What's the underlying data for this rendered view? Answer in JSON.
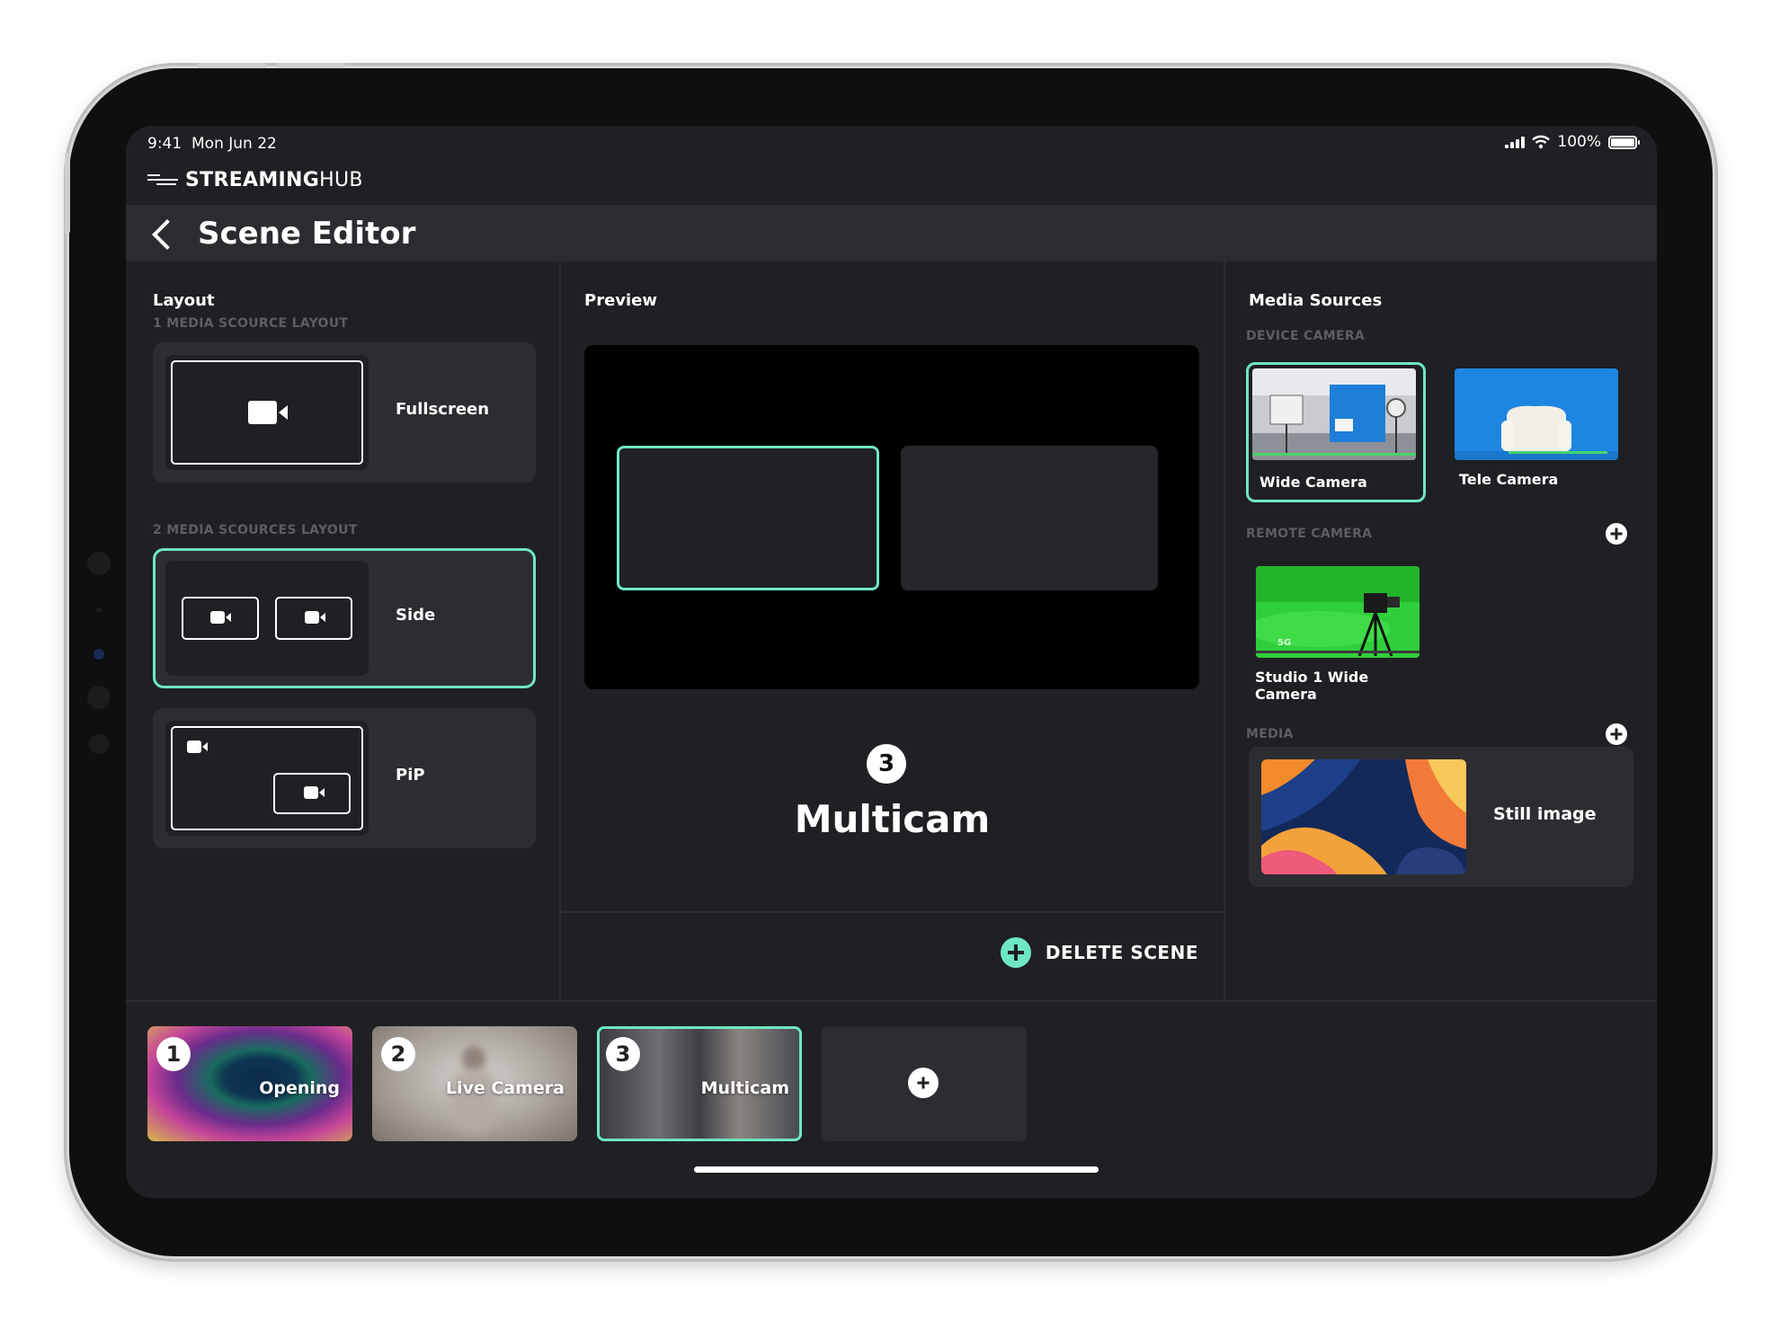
{
  "status": {
    "time": "9:41",
    "date": "Mon Jun 22",
    "battery": "100%"
  },
  "brand": {
    "name_bold": "STREAMING",
    "name_light": "HUB"
  },
  "nav": {
    "title": "Scene Editor"
  },
  "layout": {
    "title": "Layout",
    "group1": "1 MEDIA SCOURCE LAYOUT",
    "group2": "2 MEDIA SCOURCES LAYOUT",
    "items": [
      {
        "label": "Fullscreen",
        "selected": false
      },
      {
        "label": "Side",
        "selected": true
      },
      {
        "label": "PiP",
        "selected": false
      }
    ]
  },
  "preview": {
    "title": "Preview",
    "scene_number": "3",
    "scene_name": "Multicam",
    "delete_label": "DELETE SCENE"
  },
  "sources": {
    "title": "Media Sources",
    "device_camera_label": "DEVICE CAMERA",
    "device_cameras": [
      {
        "label": "Wide Camera",
        "selected": true
      },
      {
        "label": "Tele Camera",
        "selected": false
      }
    ],
    "remote_camera_label": "REMOTE CAMERA",
    "remote_cameras": [
      {
        "label": "Studio 1 Wide Camera",
        "signal": "5G"
      }
    ],
    "media_label": "MEDIA",
    "media": [
      {
        "label": "Still image"
      }
    ]
  },
  "scenes": [
    {
      "number": "1",
      "label": "Opening",
      "selected": false
    },
    {
      "number": "2",
      "label": "Live Camera",
      "selected": false
    },
    {
      "number": "3",
      "label": "Multicam",
      "selected": true
    }
  ],
  "colors": {
    "accent": "#6ee8c4",
    "background": "#1f2023",
    "card": "#2c2d31"
  }
}
